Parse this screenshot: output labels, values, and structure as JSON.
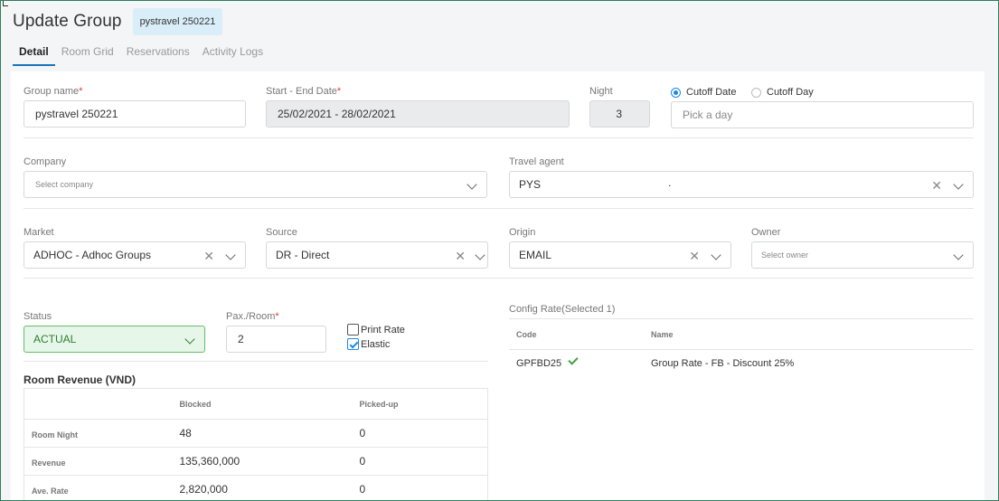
{
  "header": {
    "title": "Update Group",
    "badge": "pystravel 250221"
  },
  "tabs": [
    {
      "label": "Detail",
      "active": true
    },
    {
      "label": "Room Grid",
      "active": false
    },
    {
      "label": "Reservations",
      "active": false
    },
    {
      "label": "Activity Logs",
      "active": false
    }
  ],
  "form": {
    "group_name": {
      "label": "Group name",
      "value": "pystravel 250221",
      "required": "*"
    },
    "dates": {
      "label": "Start - End Date",
      "value": "25/02/2021 - 28/02/2021",
      "required": "*"
    },
    "night": {
      "label": "Night",
      "value": "3"
    },
    "cutoff": {
      "date_label": "Cutoff Date",
      "day_label": "Cutoff Day",
      "selected": "Cutoff Date",
      "placeholder": "Pick a day"
    },
    "company": {
      "label": "Company",
      "placeholder": "Select company"
    },
    "travel_agent": {
      "label": "Travel agent",
      "value": "PYS",
      "trailing": "."
    },
    "market": {
      "label": "Market",
      "value": "ADHOC - Adhoc Groups"
    },
    "source": {
      "label": "Source",
      "value": "DR - Direct"
    },
    "origin": {
      "label": "Origin",
      "value": "EMAIL"
    },
    "owner": {
      "label": "Owner",
      "placeholder": "Select owner"
    },
    "status": {
      "label": "Status",
      "value": "ACTUAL"
    },
    "pax_room": {
      "label": "Pax./Room",
      "value": "2",
      "required": "*"
    },
    "print_rate": {
      "label": "Print Rate",
      "checked": false
    },
    "elastic": {
      "label": "Elastic",
      "checked": true
    }
  },
  "room_revenue": {
    "title": "Room Revenue (VND)",
    "columns": [
      "",
      "Blocked",
      "Picked-up"
    ],
    "rows": [
      {
        "label": "Room Night",
        "blocked": "48",
        "picked": "0"
      },
      {
        "label": "Revenue",
        "blocked": "135,360,000",
        "picked": "0"
      },
      {
        "label": "Ave. Rate",
        "blocked": "2,820,000",
        "picked": "0"
      }
    ]
  },
  "config_rate": {
    "title": "Config Rate(Selected 1)",
    "columns": [
      "Code",
      "Name"
    ],
    "rows": [
      {
        "code": "GPFBD25",
        "name": "Group Rate - FB - Discount 25%",
        "selected": true
      }
    ]
  },
  "colors": {
    "accent": "#1e88e5",
    "status_bg": "#e6f6e9",
    "status_text": "#2e7d32",
    "required": "#e53935"
  },
  "icons": {
    "clear": "close-icon",
    "dropdown": "chevron-down-icon",
    "selected": "check-icon"
  }
}
